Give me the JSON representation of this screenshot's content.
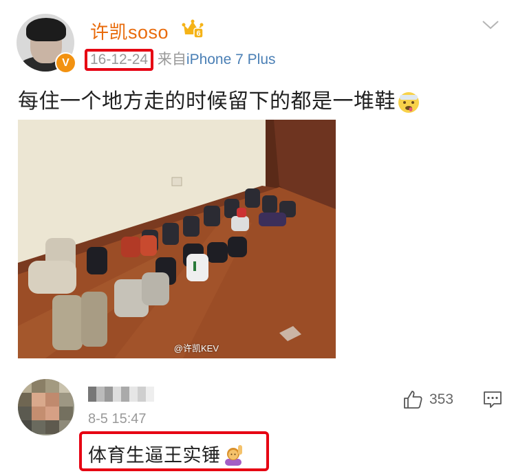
{
  "post": {
    "username": "许凯soso",
    "date": "16-12-24",
    "source_prefix": "来自",
    "device": "iPhone 7 Plus",
    "text": "每住一个地方走的时候留下的都是一堆鞋",
    "verified_badge": "V",
    "crown_level": "6",
    "photo_watermark": "@许凯KEV"
  },
  "comment": {
    "time": "8-5 15:47",
    "like_count": "353",
    "text": "体育生逼王实锤"
  },
  "colors": {
    "username": "#e86b0c",
    "device_link": "#4a7fb5",
    "highlight_box": "#e60012",
    "meta_gray": "#999999"
  }
}
